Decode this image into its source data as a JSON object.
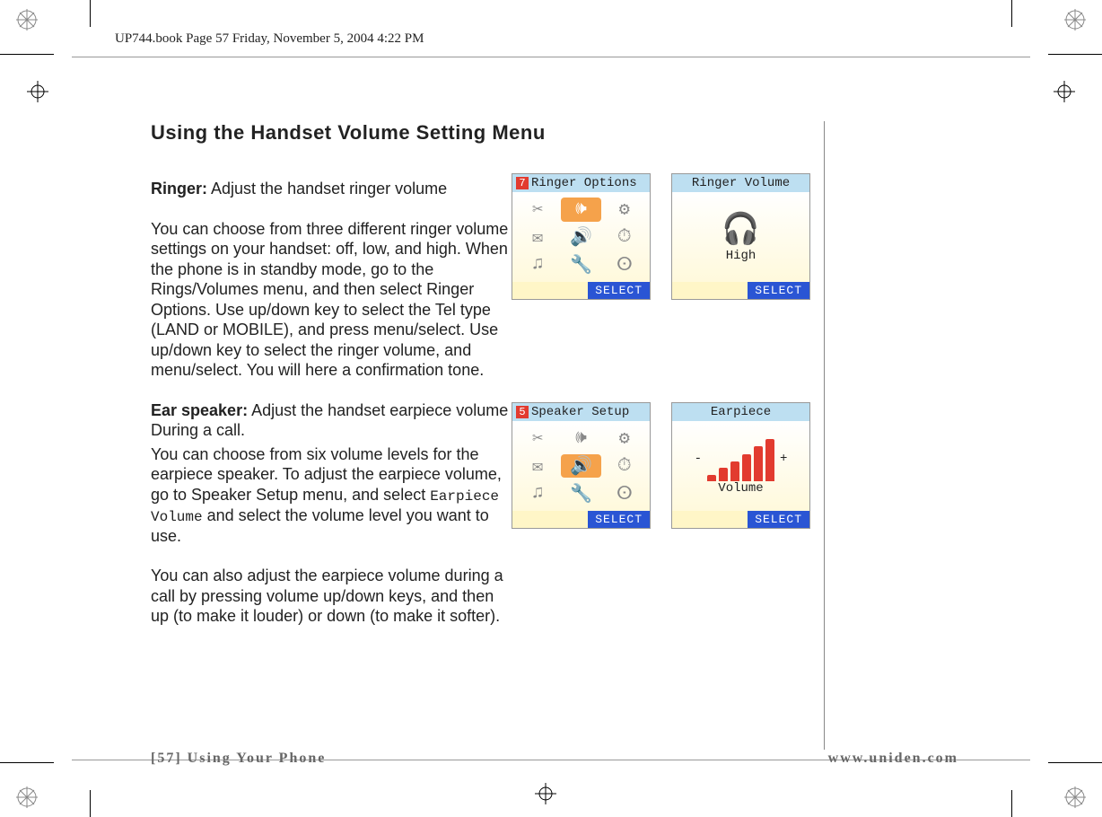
{
  "header_line": "UP744.book  Page 57  Friday, November 5, 2004  4:22 PM",
  "title": "Using the Handset Volume Setting Menu",
  "ringer": {
    "label": "Ringer:",
    "lead": "Adjust the handset ringer volume",
    "body": "You can choose from three different ringer volume settings on your handset: off, low, and high. When the phone is in standby mode, go to the Rings/Volumes menu, and then select Ringer Options. Use up/down key to select the Tel type (LAND or MOBILE), and press menu/select. Use up/down key to select the ringer volume, and menu/select. You will here a confirmation tone."
  },
  "ear": {
    "label": "Ear speaker:",
    "lead": "Adjust the handset earpiece volume During a call.",
    "body1_a": "You can choose from six volume levels for the earpiece speaker. To adjust the earpiece volume, go to Speaker Setup menu, and select ",
    "mono": "Earpiece Volume",
    "body1_b": " and select the volume level you want to use.",
    "body2": "You can also adjust the earpiece volume during a call by pressing volume up/down keys, and then up (to make it louder) or down (to make it softer)."
  },
  "screens": {
    "ringer_options": {
      "num": "7",
      "title": "Ringer Options",
      "select": "SELECT"
    },
    "ringer_volume": {
      "title": "Ringer Volume",
      "value": "High",
      "select": "SELECT"
    },
    "speaker_setup": {
      "num": "5",
      "title": "Speaker Setup",
      "select": "SELECT"
    },
    "earpiece": {
      "title": "Earpiece",
      "vol_label": "Volume",
      "minus": "-",
      "plus": "+",
      "select": "SELECT"
    }
  },
  "footer": {
    "left": "[57] Using Your Phone",
    "right": "www.uniden.com"
  }
}
